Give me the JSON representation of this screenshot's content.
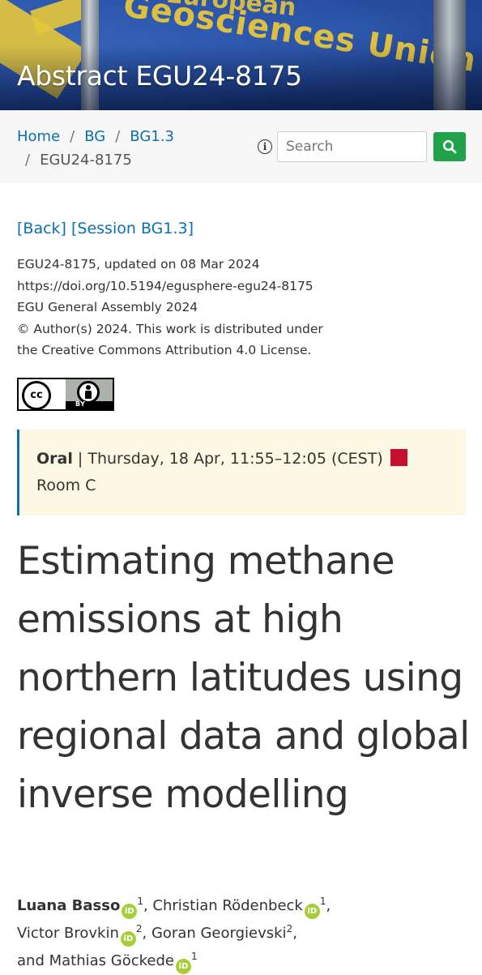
{
  "banner": {
    "title": "Abstract EGU24-8175",
    "flag_text": "Geosciences Union",
    "flag_text_top": "European"
  },
  "breadcrumb": {
    "items": [
      "Home",
      "BG",
      "BG1.3"
    ],
    "current": "EGU24-8175",
    "separator": "/"
  },
  "search": {
    "placeholder": "Search",
    "info_icon": "info-icon",
    "button_icon": "search-icon"
  },
  "links": {
    "back": "[Back]",
    "session": "[Session BG1.3]"
  },
  "meta": {
    "line1": "EGU24-8175, updated on 08 Mar 2024",
    "line2": "https://doi.org/10.5194/egusphere-egu24-8175",
    "line3": "EGU General Assembly 2024",
    "line4": "© Author(s) 2024. This work is distributed under",
    "line5": "the Creative Commons Attribution 4.0 License."
  },
  "license_badge": {
    "cc": "cc",
    "by": "BY"
  },
  "session": {
    "type": "Oral",
    "separator": " | ",
    "time": "Thursday, 18 Apr, 11:55–12:05 (CEST)",
    "room": "Room C",
    "marker_color": "#c8102e"
  },
  "title": "Estimating methane emissions at high northern latitudes using regional data and global inverse modelling",
  "authors": [
    {
      "name": "Luana Basso",
      "affil": "1",
      "presenter": true
    },
    {
      "name": "Christian Rödenbeck",
      "affil": "1",
      "presenter": false
    },
    {
      "name": "Victor Brovkin",
      "affil": "2",
      "presenter": false
    },
    {
      "name": "Goran Georgievski",
      "affil": "2",
      "presenter": false
    },
    {
      "name": "Mathias Göckede",
      "affil": "1",
      "presenter": false
    }
  ],
  "author_conjunction": "and",
  "orcid_label": "iD",
  "colors": {
    "link": "#0b6fb0",
    "search_button": "#1fa24a",
    "session_bg": "#fcf8e3",
    "orcid": "#a6ce39"
  }
}
